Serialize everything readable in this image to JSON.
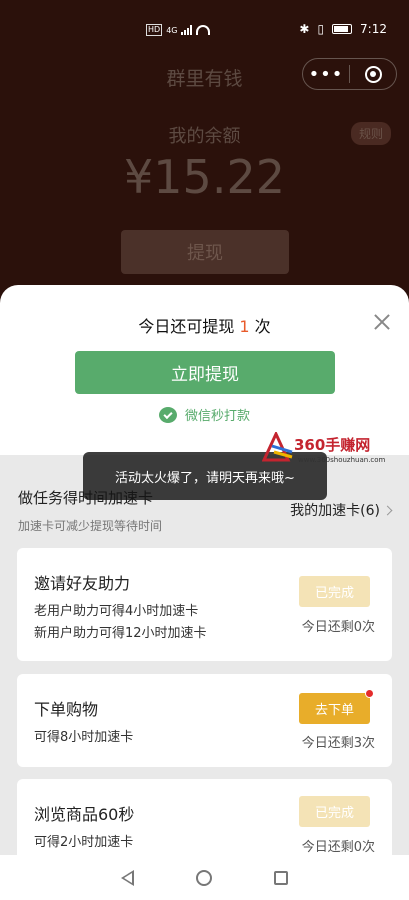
{
  "status_bar": {
    "hd": "HD",
    "signal_label": "4G",
    "time": "7:12"
  },
  "header": {
    "title": "群里有钱",
    "more_icon": "more-icon",
    "close_icon": "target-icon"
  },
  "balance": {
    "label": "我的余额",
    "rules": "规则",
    "amount": "¥15.22",
    "withdraw": "提现"
  },
  "panel": {
    "prefix": "今日还可提现 ",
    "count": "1",
    "suffix": " 次",
    "primary": "立即提现",
    "note": "微信秒打款",
    "accent": "#58ab6c"
  },
  "toast": "活动太火爆了，请明天再来哦~",
  "watermark": {
    "main": "360手赚网",
    "sub": "www.360shouzhuan.com"
  },
  "tasks": {
    "title": "做任务得时间加速卡",
    "subtitle": "加速卡可减少提现等待时间",
    "my_cards": "我的加速卡(6)",
    "items": [
      {
        "title": "邀请好友助力",
        "lines": [
          "老用户助力可得4小时加速卡",
          "新用户助力可得12小时加速卡"
        ],
        "button": "已完成",
        "remain": "今日还剩0次"
      },
      {
        "title": "下单购物",
        "lines": [
          "可得8小时加速卡"
        ],
        "button": "去下单",
        "remain": "今日还剩3次"
      },
      {
        "title": "浏览商品60秒",
        "lines": [
          "可得2小时加速卡"
        ],
        "button": "已完成",
        "remain": "今日还剩0次"
      }
    ]
  }
}
